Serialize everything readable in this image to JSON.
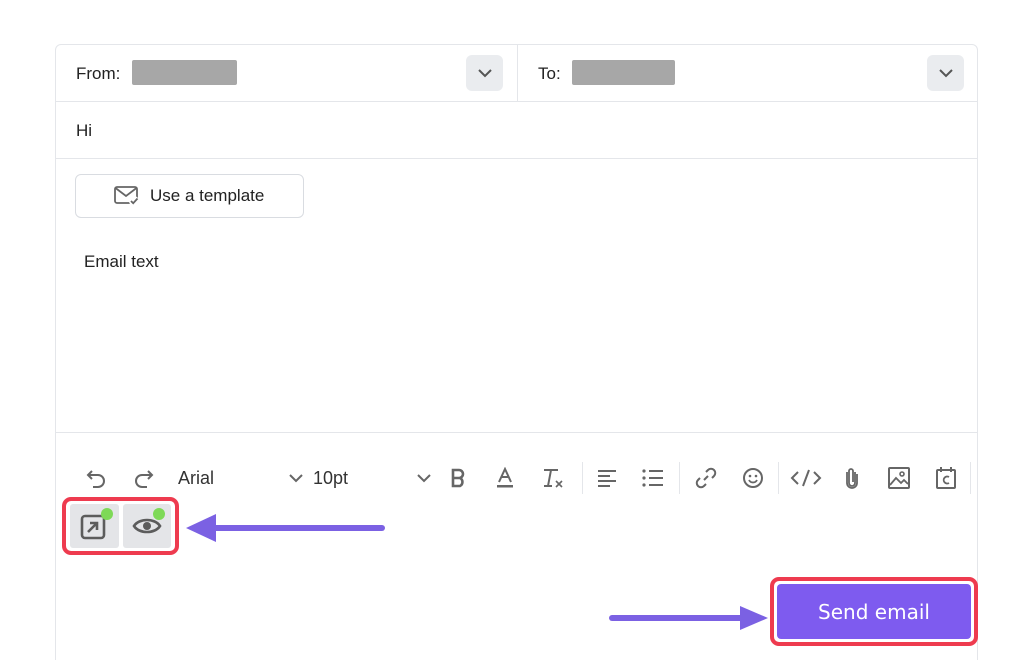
{
  "compose": {
    "from_label": "From:",
    "to_label": "To:",
    "subject": "Hi",
    "template_button_label": "Use a template",
    "body_text": "Email text",
    "send_button_label": "Send email"
  },
  "toolbar": {
    "font_family": "Arial",
    "font_size": "10pt",
    "icons": [
      "undo-icon",
      "redo-icon",
      "bold-icon",
      "text-color-icon",
      "clear-format-icon",
      "align-left-icon",
      "bullet-list-icon",
      "link-icon",
      "emoji-icon",
      "code-icon",
      "attachment-icon",
      "image-icon",
      "calendar-icon"
    ]
  },
  "addons": [
    {
      "name": "open-external-icon",
      "status_color": "#7ed957"
    },
    {
      "name": "eye-icon",
      "status_color": "#7ed957"
    }
  ],
  "colors": {
    "accent": "#7e5bef",
    "highlight": "#ee3b4f",
    "arrow": "#7b61e3"
  }
}
